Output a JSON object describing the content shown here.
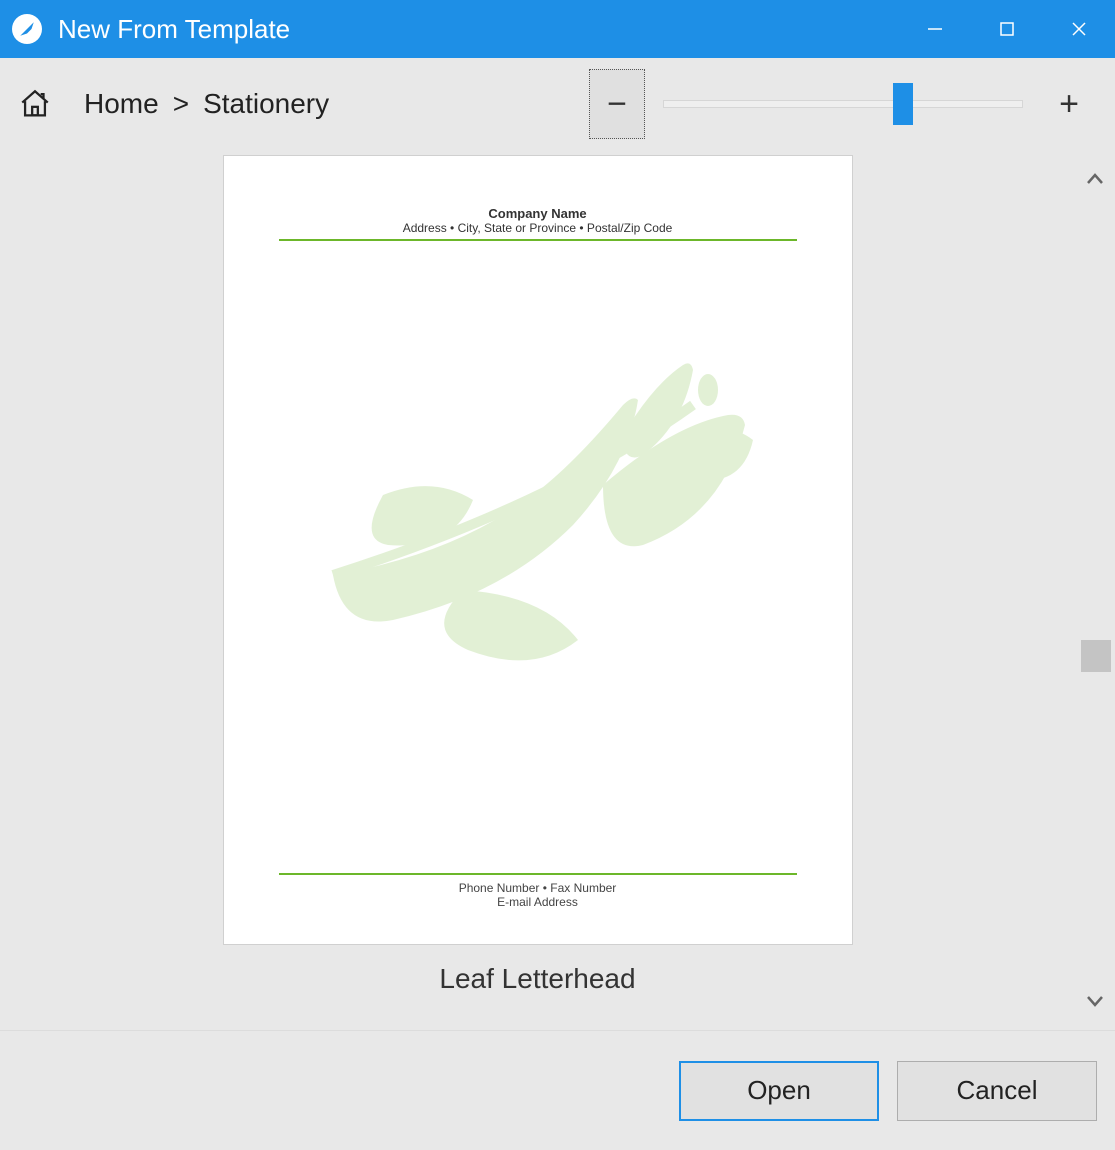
{
  "window": {
    "title": "New From Template"
  },
  "breadcrumb": {
    "home_label": "Home",
    "separator": ">",
    "current": "Stationery"
  },
  "zoom": {
    "minus_label": "−",
    "plus_label": "+",
    "slider_percent": 64
  },
  "template": {
    "name": "Leaf Letterhead",
    "preview": {
      "company_name": "Company Name",
      "address": "Address • City, State or Province • Postal/Zip Code",
      "phone_fax": "Phone Number • Fax Number",
      "email": "E-mail Address"
    },
    "accent_color": "#6CB72A",
    "leaf_color": "#BFDFA4"
  },
  "footer": {
    "open": "Open",
    "cancel": "Cancel"
  },
  "colors": {
    "title_bar": "#1e8fe6",
    "chrome_bg": "#e8e8e8"
  }
}
